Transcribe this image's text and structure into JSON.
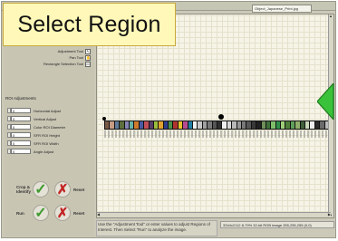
{
  "callout": {
    "label": "Select Region"
  },
  "window": {
    "filename": "Object_Japanese_Print.jpg"
  },
  "tools": [
    {
      "label": "Adjustment Tool",
      "icon": "pointer-icon",
      "glyph": "↖"
    },
    {
      "label": "Pan Tool",
      "icon": "hand-icon",
      "glyph": "✋"
    },
    {
      "label": "Rectangle Selection Tool",
      "icon": "rectangle-icon",
      "glyph": "▭"
    }
  ],
  "roi": {
    "title": "ROI Adjustments",
    "items": [
      {
        "value": "0",
        "label": "Horizontal Adjust"
      },
      {
        "value": "0",
        "label": "Vertical Adjust"
      },
      {
        "value": "0",
        "label": "Color ROI Diameter"
      },
      {
        "value": "0",
        "label": "SFR ROI Height"
      },
      {
        "value": "0",
        "label": "SFR ROI Width"
      },
      {
        "value": "0",
        "label": "Angle Adjust"
      }
    ]
  },
  "actions": {
    "crop_label": "Crop & Identify",
    "run_label": "Run",
    "reset_label": "Reset"
  },
  "status": {
    "message": "Use the \"Adjustment Tool\" or enter values to adjust Regions of Interest. Then Select \"Run\" to analyze the image.",
    "image_info": "3344x2112 8-79% 32-bit RGB image 255,255,255 (0,0)"
  },
  "target_colors": [
    "#7a5a45",
    "#c69a83",
    "#617a9c",
    "#5d6f3c",
    "#8584b3",
    "#67b3a7",
    "#d07a2c",
    "#4a5aa3",
    "#c24e5a",
    "#5a3c68",
    "#9cbb3e",
    "#e0a22e",
    "#2e3d8c",
    "#4a9147",
    "#b0342e",
    "#e8c22c",
    "#b84a8f",
    "#1f7fa3",
    "#f2f2f2",
    "#c8c8c8",
    "#a0a0a0",
    "#7a7a7a",
    "#555555",
    "#303030",
    "#f0f0f0",
    "#d8d8d8",
    "#b8b8b8",
    "#989898",
    "#787878",
    "#585858",
    "#383838",
    "#202020",
    "#6f8f5a",
    "#3f6f3a",
    "#7fbf6a",
    "#2f8f4a",
    "#9fcf7a",
    "#4f7f3a",
    "#5f9f5a",
    "#8faf6a",
    "#3f5f3a",
    "#c8d8b8",
    "#efefef",
    "#2a2a2a",
    "#6a6a6a",
    "#bcbcbc"
  ]
}
